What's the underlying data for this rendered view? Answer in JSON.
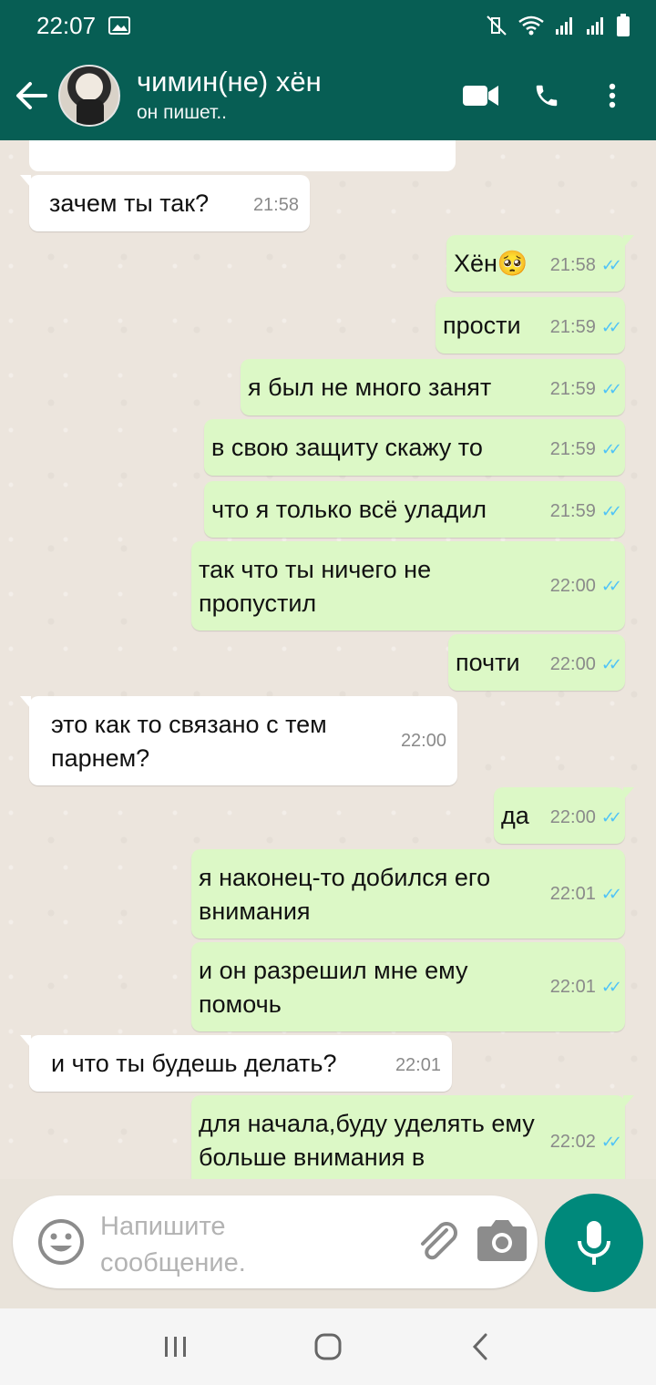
{
  "status_bar": {
    "time": "22:07"
  },
  "header": {
    "title": "чимин(не) хён",
    "status": "он пишет.."
  },
  "messages": [
    {
      "dir": "in",
      "text": "зачем ты так?",
      "time": "21:58"
    },
    {
      "dir": "out",
      "text": "Хён🥺",
      "time": "21:58"
    },
    {
      "dir": "out",
      "text": "прости",
      "time": "21:59"
    },
    {
      "dir": "out",
      "text": "я был не много занят",
      "time": "21:59"
    },
    {
      "dir": "out",
      "text": "в свою защиту скажу то",
      "time": "21:59"
    },
    {
      "dir": "out",
      "text": "что я только всё уладил",
      "time": "21:59"
    },
    {
      "dir": "out",
      "text": "так что ты ничего не пропустил",
      "time": "22:00"
    },
    {
      "dir": "out",
      "text": "почти",
      "time": "22:00"
    },
    {
      "dir": "in",
      "text": "это как то связано с тем парнем?",
      "time": "22:00"
    },
    {
      "dir": "out",
      "text": "да",
      "time": "22:00"
    },
    {
      "dir": "out",
      "text": "я наконец-то добился его внимания",
      "time": "22:01"
    },
    {
      "dir": "out",
      "text": "и он разрешил мне ему помочь",
      "time": "22:01"
    },
    {
      "dir": "in",
      "text": "и что ты будешь делать?",
      "time": "22:01"
    },
    {
      "dir": "out",
      "text": "для начала,буду уделять ему больше внимания в",
      "time": "22:02"
    }
  ],
  "composer": {
    "placeholder": "Напишите сообщение."
  },
  "colors": {
    "header_bg": "#075e54",
    "outgoing_bubble": "#dcf8c6",
    "incoming_bubble": "#ffffff",
    "mic_button": "#00897b",
    "read_ticks": "#4fc3f7"
  },
  "icons": {
    "back": "arrow-left-icon",
    "video": "video-camera-icon",
    "call": "phone-icon",
    "menu": "more-vertical-icon",
    "emoji": "emoji-icon",
    "attach": "paperclip-icon",
    "camera": "camera-icon",
    "mic": "microphone-icon"
  }
}
